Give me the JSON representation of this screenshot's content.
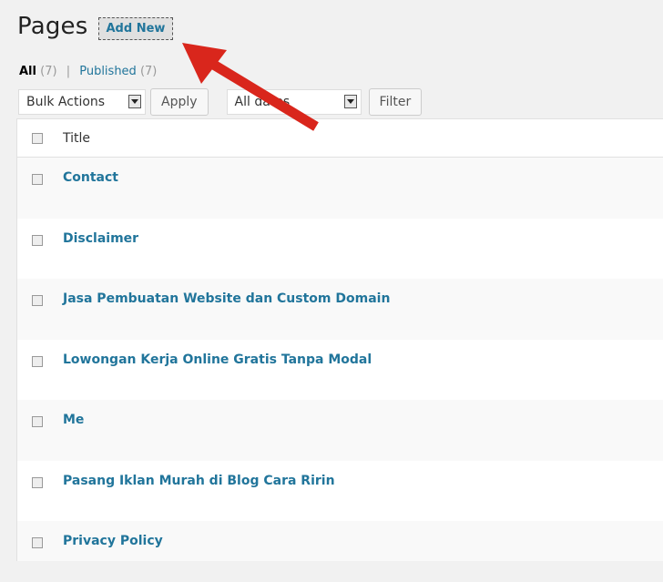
{
  "header": {
    "title": "Pages",
    "add_new_label": "Add New"
  },
  "filters": {
    "all_label": "All",
    "all_count": "(7)",
    "separator": "|",
    "published_label": "Published",
    "published_count": "(7)"
  },
  "tablenav": {
    "bulk_actions": "Bulk Actions",
    "apply_label": "Apply",
    "dates": "All dates",
    "filter_label": "Filter"
  },
  "table": {
    "column_title": "Title",
    "rows": [
      "Contact",
      "Disclaimer",
      "Jasa Pembuatan Website dan Custom Domain",
      "Lowongan Kerja Online Gratis Tanpa Modal",
      "Me",
      "Pasang Iklan Murah di Blog Cara Ririn",
      "Privacy Policy"
    ]
  },
  "annotation": {
    "arrow_color": "#d9261c"
  }
}
